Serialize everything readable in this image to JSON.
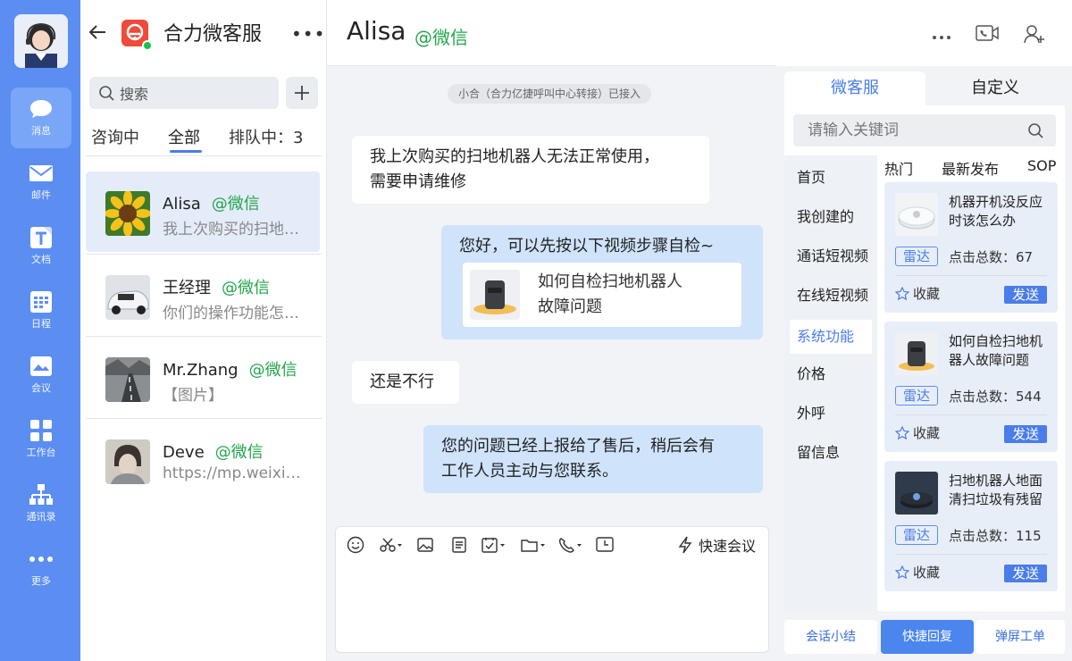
{
  "rail": {
    "items": [
      {
        "label": "消息",
        "icon": "chat-bubble-icon",
        "active": true
      },
      {
        "label": "邮件",
        "icon": "mail-icon"
      },
      {
        "label": "文档",
        "icon": "document-icon"
      },
      {
        "label": "日程",
        "icon": "calendar-icon"
      },
      {
        "label": "会议",
        "icon": "meeting-icon"
      },
      {
        "label": "工作台",
        "icon": "grid-icon"
      },
      {
        "label": "通讯录",
        "icon": "org-chart-icon"
      },
      {
        "label": "更多",
        "icon": "more-dots-icon"
      }
    ]
  },
  "list": {
    "app_name": "合力微客服",
    "search_placeholder": "搜索",
    "tabs": {
      "consulting": "咨询中",
      "all": "全部",
      "queue": "排队中：3"
    },
    "contacts": [
      {
        "name": "Alisa",
        "source": "@微信",
        "preview": "我上次购买的扫地机器人无法正常使用，需要申请维修"
      },
      {
        "name": "王经理",
        "source": "@微信",
        "preview": "你们的操作功能怎么使用"
      },
      {
        "name": "Mr.Zhang",
        "source": "@微信",
        "preview": "【图片】"
      },
      {
        "name": "Deve",
        "source": "@微信",
        "preview": "https://mp.weixin.qq.com"
      }
    ]
  },
  "chat": {
    "name": "Alisa",
    "source": "@微信",
    "notice": "小合（合力亿捷呼叫中心转接）已接入",
    "messages": [
      {
        "dir": "in",
        "text1": "我上次购买的扫地机器人无法正常使用，",
        "text2": "需要申请维修"
      },
      {
        "dir": "out",
        "text": "您好，可以先按以下视频步骤自检~",
        "card_title1": "如何自检扫地机器人",
        "card_title2": "故障问题"
      },
      {
        "dir": "in",
        "text": "还是不行"
      },
      {
        "dir": "out",
        "text1": "您的问题已经上报给了售后，稍后会有",
        "text2": "工作人员主动与您联系。"
      }
    ],
    "composer": {
      "quick_meeting": "快速会议"
    }
  },
  "panel": {
    "tabs": {
      "kefu": "微客服",
      "custom": "自定义"
    },
    "search_placeholder": "请输入关键词",
    "categories": [
      "首页",
      "我创建的",
      "通话短视频",
      "在线短视频",
      "系统功能",
      "价格",
      "外呼",
      "留信息"
    ],
    "active_category": "系统功能",
    "subtabs": {
      "hot": "热门",
      "latest": "最新发布",
      "sop": "SOP"
    },
    "cards": [
      {
        "title": "机器开机没反应时该怎么办",
        "tag": "雷达",
        "clicks": "点击总数：67",
        "fav": "收藏",
        "send": "发送"
      },
      {
        "title": "如何自检扫地机器人故障问题",
        "tag": "雷达",
        "clicks": "点击总数：544",
        "fav": "收藏",
        "send": "发送"
      },
      {
        "title": "扫地机器人地面清扫垃圾有残留怎么办",
        "tag": "雷达",
        "clicks": "点击总数：115",
        "fav": "收藏",
        "send": "发送"
      }
    ],
    "bottom": {
      "summary": "会话小结",
      "quick_reply": "快捷回复",
      "popup_ticket": "弹屏工单"
    }
  }
}
